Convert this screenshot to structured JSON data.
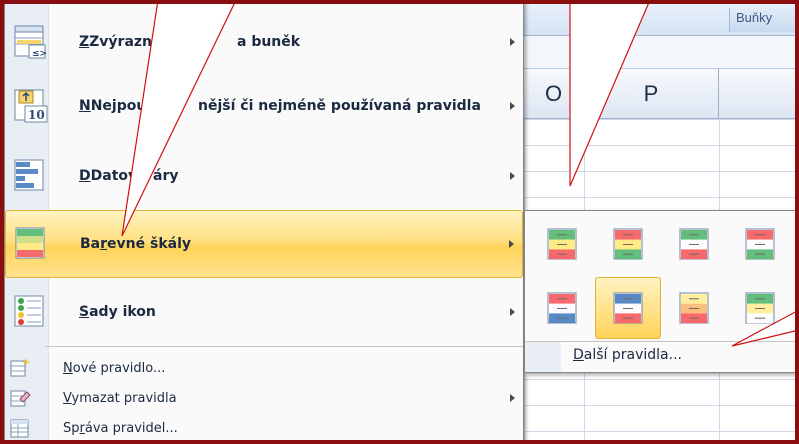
{
  "ribbon": {
    "group_label": "Buňky"
  },
  "columns": [
    "O",
    "P"
  ],
  "menu": {
    "items": [
      {
        "id": "highlight",
        "pre": "",
        "key": "Z",
        "post": "výraznit pravidla buněk",
        "visible_pre": "Zvýraznit",
        "visible_post": "a buněk",
        "has_arrow": true
      },
      {
        "id": "topbottom",
        "pre": "",
        "key": "N",
        "post": "ejpoužívanější či nejméně používaná pravidla",
        "visible_pre": "Nejpou",
        "visible_post": "nější či nejméně používaná pravidla",
        "has_arrow": true
      },
      {
        "id": "databars",
        "pre": "",
        "key": "D",
        "post": "atové pruhy",
        "visible_pre": "Datov",
        "visible_post": "áry",
        "has_arrow": true
      },
      {
        "id": "colorscales",
        "pre": "Ba",
        "key": "r",
        "post": "evné škály",
        "has_arrow": true
      },
      {
        "id": "iconsets",
        "pre": "",
        "key": "S",
        "post": "ady ikon",
        "has_arrow": true
      }
    ],
    "small_items": [
      {
        "id": "newrule",
        "pre": "",
        "key": "N",
        "post": "ové pravidlo...",
        "has_arrow": false
      },
      {
        "id": "clearrules",
        "pre": "",
        "key": "V",
        "post": "ymazat pravidla",
        "has_arrow": true
      },
      {
        "id": "managerules",
        "pre": "Sp",
        "key": "r",
        "post": "áva pravidel...",
        "has_arrow": false
      }
    ]
  },
  "submenu": {
    "more_pre": "",
    "more_key": "D",
    "more_post": "alší pravidla...",
    "scales": [
      [
        "#63be7b",
        "#ffeb84",
        "#f8696b"
      ],
      [
        "#f8696b",
        "#ffeb84",
        "#63be7b"
      ],
      [
        "#63be7b",
        "#fcfcff",
        "#f8696b"
      ],
      [
        "#f8696b",
        "#fcfcff",
        "#63be7b"
      ],
      [
        "#f8696b",
        "#fcfcff",
        "#5a8ac6"
      ],
      [
        "#5a8ac6",
        "#fcfcff",
        "#f8696b"
      ],
      [
        "#ffef9c",
        "#fcbf7b",
        "#f8696b"
      ],
      [
        "#63be7b",
        "#ffef9c",
        "#fcfcff"
      ]
    ],
    "selected_index": 5
  },
  "colors": {
    "highlight": "#ffd35a",
    "frame": "#7a0a0c",
    "callout_line": "#e00000"
  }
}
